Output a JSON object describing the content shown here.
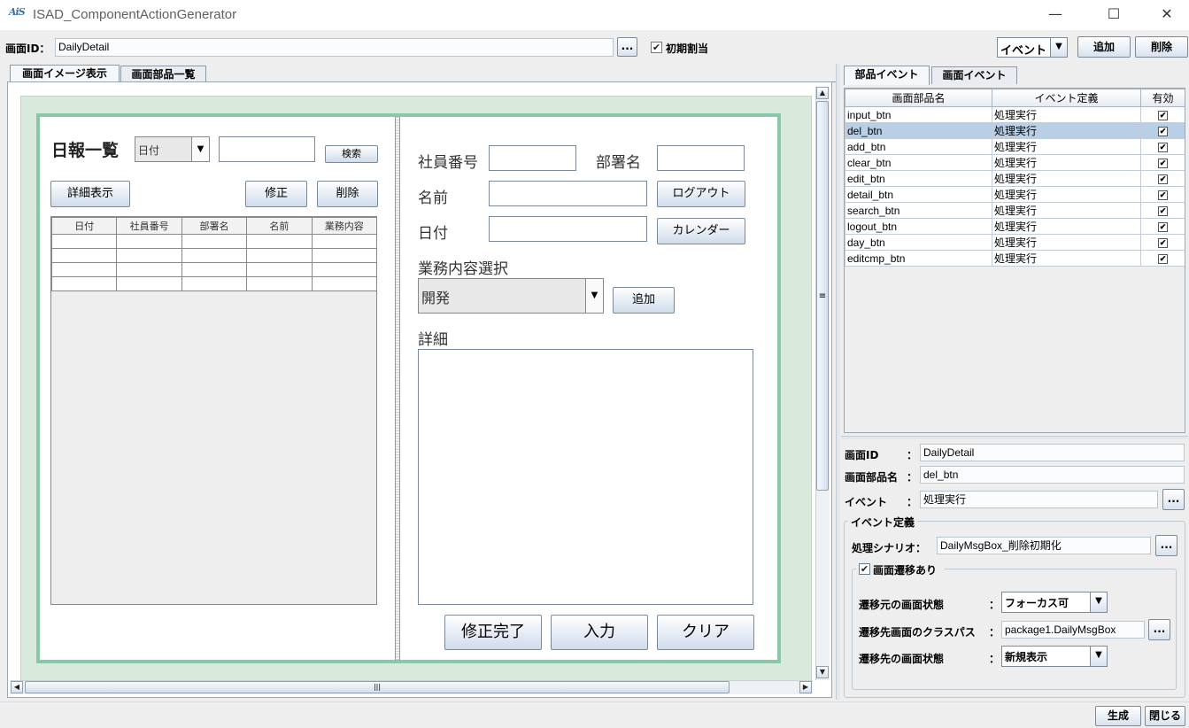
{
  "window": {
    "logo": "AiS",
    "title": "ISAD_ComponentActionGenerator",
    "minimize": "—",
    "maximize": "☐",
    "close": "✕"
  },
  "toolbar": {
    "screen_id_label": "画面ID：",
    "screen_id_value": "DailyDetail",
    "browse": "...",
    "init_checked": "✔",
    "init_label": "初期割当",
    "event_select": "イベント",
    "add_button": "追加",
    "delete_button": "削除"
  },
  "left_tabs": [
    "画面イメージ表示",
    "画面部品一覧"
  ],
  "designer": {
    "title": "日報一覧",
    "date_select": "日付",
    "search_button": "検索",
    "detail_button": "詳細表示",
    "edit_button": "修正",
    "delete_button": "削除",
    "table_headers": [
      "日付",
      "社員番号",
      "部署名",
      "名前",
      "業務内容"
    ],
    "employee_no_label": "社員番号",
    "dept_label": "部署名",
    "name_label": "名前",
    "logout_button": "ログアウト",
    "date_label": "日付",
    "calendar_button": "カレンダー",
    "task_select_label": "業務内容選択",
    "task_select_value": "開発",
    "task_add_button": "追加",
    "detail_label": "詳細",
    "edit_done_button": "修正完了",
    "input_button": "入力",
    "clear_button": "クリア"
  },
  "right_tabs": [
    "部品イベント",
    "画面イベント"
  ],
  "event_table": {
    "headers": [
      "画面部品名",
      "イベント定義",
      "有効"
    ],
    "rows": [
      {
        "name": "input_btn",
        "event": "処理実行",
        "enabled": "✔"
      },
      {
        "name": "del_btn",
        "event": "処理実行",
        "enabled": "✔",
        "selected": true
      },
      {
        "name": "add_btn",
        "event": "処理実行",
        "enabled": "✔"
      },
      {
        "name": "clear_btn",
        "event": "処理実行",
        "enabled": "✔"
      },
      {
        "name": "edit_btn",
        "event": "処理実行",
        "enabled": "✔"
      },
      {
        "name": "detail_btn",
        "event": "処理実行",
        "enabled": "✔"
      },
      {
        "name": "search_btn",
        "event": "処理実行",
        "enabled": "✔"
      },
      {
        "name": "logout_btn",
        "event": "処理実行",
        "enabled": "✔"
      },
      {
        "name": "day_btn",
        "event": "処理実行",
        "enabled": "✔"
      },
      {
        "name": "editcmp_btn",
        "event": "処理実行",
        "enabled": "✔"
      }
    ]
  },
  "detail": {
    "screen_id_label": "画面ID",
    "colon": "：",
    "screen_id_value": "DailyDetail",
    "part_name_label": "画面部品名",
    "part_name_value": "del_btn",
    "event_label": "イベント",
    "event_value": "処理実行",
    "browse": "...",
    "event_def_group": "イベント定義",
    "scenario_label": "処理シナリオ：",
    "scenario_value": "DailyMsgBox_削除初期化",
    "transition_checked": "✔",
    "transition_label": "画面遷移あり",
    "src_state_label": "遷移元の画面状態",
    "src_state_value": "フォーカス可",
    "dest_class_label": "遷移先画面のクラスパス",
    "dest_class_value": "package1.DailyMsgBox",
    "dest_state_label": "遷移先の画面状態",
    "dest_state_value": "新規表示"
  },
  "footer": {
    "generate_button": "生成",
    "close_button": "閉じる"
  },
  "icons": {
    "dropdown": "▼",
    "scroll_up": "▲",
    "scroll_down": "▼",
    "scroll_left": "◀",
    "scroll_right": "▶",
    "grip_v": "≡",
    "grip_h": "|||"
  }
}
